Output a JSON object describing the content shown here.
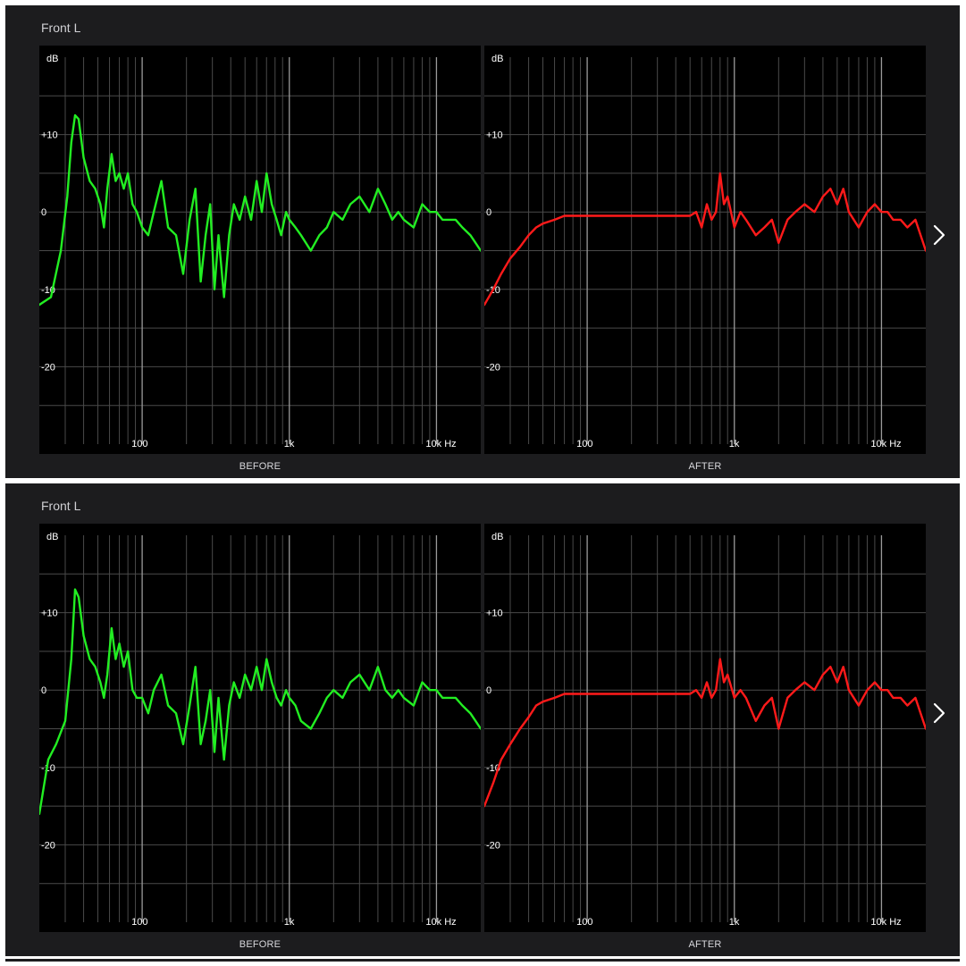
{
  "colors": {
    "panel_bg": "#1c1c1e",
    "plot_bg": "#000000",
    "grid": "#4a4a4a",
    "decade_grid": "#9a9a9a",
    "before_curve": "#22ee22",
    "after_curve": "#ff1a1a",
    "text": "#ffffff"
  },
  "icons": {
    "next": "chevron-right-icon"
  },
  "panels": [
    {
      "title": "Front L",
      "before_label": "BEFORE",
      "after_label": "AFTER",
      "y_unit": "dB",
      "x_unit_label": "10k Hz"
    },
    {
      "title": "Front L",
      "before_label": "BEFORE",
      "after_label": "AFTER",
      "y_unit": "dB",
      "x_unit_label": "10k Hz"
    }
  ],
  "chart_data": [
    {
      "type": "line",
      "title": "",
      "xlabel": "",
      "ylabel": "dB",
      "x_scale": "log",
      "xlim": [
        20,
        20000
      ],
      "ylim": [
        -30,
        20
      ],
      "x_ticks": [
        {
          "value": 100,
          "label": "100"
        },
        {
          "value": 1000,
          "label": "1k"
        },
        {
          "value": 10000,
          "label": "10k Hz"
        }
      ],
      "y_ticks": [
        {
          "value": 10,
          "label": "+10"
        },
        {
          "value": 0,
          "label": "0"
        },
        {
          "value": -10,
          "label": "-10"
        },
        {
          "value": -20,
          "label": "-20"
        }
      ],
      "grid": true,
      "series": [
        {
          "name": "",
          "color": "#22ee22",
          "x": [
            20,
            24,
            28,
            31,
            33,
            35,
            37,
            40,
            44,
            48,
            52,
            55,
            58,
            62,
            66,
            70,
            75,
            80,
            86,
            92,
            100,
            110,
            120,
            135,
            150,
            170,
            190,
            210,
            230,
            250,
            270,
            290,
            310,
            330,
            360,
            390,
            420,
            460,
            500,
            550,
            600,
            650,
            700,
            760,
            820,
            880,
            950,
            1000,
            1100,
            1200,
            1400,
            1600,
            1800,
            2000,
            2300,
            2600,
            3000,
            3500,
            4000,
            4500,
            5000,
            5500,
            6000,
            7000,
            8000,
            9000,
            10000,
            11000,
            12000,
            13500,
            15000,
            17000,
            20000
          ],
          "y": [
            -12,
            -11,
            -5,
            2,
            9,
            12.5,
            12,
            7,
            4,
            3,
            1,
            -2,
            3,
            7.5,
            4,
            5,
            3,
            5,
            1,
            0,
            -2,
            -3,
            0,
            4,
            -2,
            -3,
            -8,
            -1,
            3,
            -9,
            -3,
            1,
            -10,
            -3,
            -11,
            -3,
            1,
            -1,
            2,
            -1,
            4,
            0,
            5,
            1,
            -1,
            -3,
            0,
            -1,
            -2,
            -3,
            -5,
            -3,
            -2,
            0,
            -1,
            1,
            2,
            0,
            3,
            1,
            -1,
            0,
            -1,
            -2,
            1,
            0,
            0,
            -1,
            -1,
            -1,
            -2,
            -3,
            -5
          ]
        }
      ]
    },
    {
      "type": "line",
      "title": "",
      "xlabel": "",
      "ylabel": "dB",
      "x_scale": "log",
      "xlim": [
        20,
        20000
      ],
      "ylim": [
        -30,
        20
      ],
      "x_ticks": [
        {
          "value": 100,
          "label": "100"
        },
        {
          "value": 1000,
          "label": "1k"
        },
        {
          "value": 10000,
          "label": "10k Hz"
        }
      ],
      "y_ticks": [
        {
          "value": 10,
          "label": "+10"
        },
        {
          "value": 0,
          "label": "0"
        },
        {
          "value": -10,
          "label": "-10"
        },
        {
          "value": -20,
          "label": "-20"
        }
      ],
      "grid": true,
      "series": [
        {
          "name": "",
          "color": "#ff1a1a",
          "x": [
            20,
            23,
            26,
            30,
            35,
            40,
            45,
            50,
            60,
            70,
            80,
            90,
            100,
            150,
            200,
            250,
            300,
            400,
            450,
            500,
            550,
            600,
            650,
            700,
            750,
            800,
            850,
            900,
            1000,
            1100,
            1200,
            1400,
            1600,
            1800,
            2000,
            2300,
            2600,
            3000,
            3500,
            4000,
            4500,
            5000,
            5500,
            6000,
            7000,
            8000,
            9000,
            10000,
            11000,
            12000,
            13500,
            15000,
            17000,
            20000
          ],
          "y": [
            -12,
            -10,
            -8,
            -6,
            -4.5,
            -3,
            -2,
            -1.5,
            -1,
            -0.5,
            -0.5,
            -0.5,
            -0.5,
            -0.5,
            -0.5,
            -0.5,
            -0.5,
            -0.5,
            -0.5,
            -0.5,
            0,
            -2,
            1,
            -1,
            0,
            5,
            1,
            2,
            -2,
            0,
            -1,
            -3,
            -2,
            -1,
            -4,
            -1,
            0,
            1,
            0,
            2,
            3,
            1,
            3,
            0,
            -2,
            0,
            1,
            0,
            0,
            -1,
            -1,
            -2,
            -1,
            -5
          ]
        }
      ]
    },
    {
      "type": "line",
      "title": "",
      "xlabel": "",
      "ylabel": "dB",
      "x_scale": "log",
      "xlim": [
        20,
        20000
      ],
      "ylim": [
        -30,
        20
      ],
      "x_ticks": [
        {
          "value": 100,
          "label": "100"
        },
        {
          "value": 1000,
          "label": "1k"
        },
        {
          "value": 10000,
          "label": "10k Hz"
        }
      ],
      "y_ticks": [
        {
          "value": 10,
          "label": "+10"
        },
        {
          "value": 0,
          "label": "0"
        },
        {
          "value": -10,
          "label": "-10"
        },
        {
          "value": -20,
          "label": "-20"
        }
      ],
      "grid": true,
      "series": [
        {
          "name": "",
          "color": "#22ee22",
          "x": [
            20,
            23,
            26,
            30,
            33,
            35,
            37,
            40,
            44,
            48,
            52,
            55,
            58,
            62,
            66,
            70,
            75,
            80,
            86,
            92,
            100,
            110,
            120,
            135,
            150,
            170,
            190,
            210,
            230,
            250,
            270,
            290,
            310,
            330,
            360,
            390,
            420,
            460,
            500,
            550,
            600,
            650,
            700,
            760,
            820,
            880,
            950,
            1000,
            1100,
            1200,
            1400,
            1600,
            1800,
            2000,
            2300,
            2600,
            3000,
            3500,
            4000,
            4500,
            5000,
            5500,
            6000,
            7000,
            8000,
            9000,
            10000,
            11000,
            12000,
            13500,
            15000,
            17000,
            20000
          ],
          "y": [
            -16,
            -9,
            -7,
            -4,
            4,
            13,
            12,
            7,
            4,
            3,
            1,
            -1,
            2,
            8,
            4,
            6,
            3,
            5,
            0,
            -1,
            -1,
            -3,
            0,
            2,
            -2,
            -3,
            -7,
            -2,
            3,
            -7,
            -4,
            0,
            -8,
            -1,
            -9,
            -2,
            1,
            -1,
            2,
            0,
            3,
            0,
            4,
            1,
            -1,
            -2,
            0,
            -1,
            -2,
            -4,
            -5,
            -3,
            -1,
            0,
            -1,
            1,
            2,
            0,
            3,
            0,
            -1,
            0,
            -1,
            -2,
            1,
            0,
            0,
            -1,
            -1,
            -1,
            -2,
            -3,
            -5
          ]
        }
      ]
    },
    {
      "type": "line",
      "title": "",
      "xlabel": "",
      "ylabel": "dB",
      "x_scale": "log",
      "xlim": [
        20,
        20000
      ],
      "ylim": [
        -30,
        20
      ],
      "x_ticks": [
        {
          "value": 100,
          "label": "100"
        },
        {
          "value": 1000,
          "label": "1k"
        },
        {
          "value": 10000,
          "label": "10k Hz"
        }
      ],
      "y_ticks": [
        {
          "value": 10,
          "label": "+10"
        },
        {
          "value": 0,
          "label": "0"
        },
        {
          "value": -10,
          "label": "-10"
        },
        {
          "value": -20,
          "label": "-20"
        }
      ],
      "grid": true,
      "series": [
        {
          "name": "",
          "color": "#ff1a1a",
          "x": [
            20,
            23,
            26,
            30,
            35,
            40,
            45,
            50,
            60,
            70,
            80,
            90,
            100,
            150,
            200,
            250,
            300,
            400,
            450,
            500,
            550,
            600,
            650,
            700,
            750,
            800,
            850,
            900,
            1000,
            1100,
            1200,
            1400,
            1600,
            1800,
            2000,
            2300,
            2600,
            3000,
            3500,
            4000,
            4500,
            5000,
            5500,
            6000,
            7000,
            8000,
            9000,
            10000,
            11000,
            12000,
            13500,
            15000,
            17000,
            20000
          ],
          "y": [
            -15,
            -12,
            -9,
            -7,
            -5,
            -3.5,
            -2,
            -1.5,
            -1,
            -0.5,
            -0.5,
            -0.5,
            -0.5,
            -0.5,
            -0.5,
            -0.5,
            -0.5,
            -0.5,
            -0.5,
            -0.5,
            0,
            -1,
            1,
            -1,
            0,
            4,
            1,
            2,
            -1,
            0,
            -1,
            -4,
            -2,
            -1,
            -5,
            -1,
            0,
            1,
            0,
            2,
            3,
            1,
            3,
            0,
            -2,
            0,
            1,
            0,
            0,
            -1,
            -1,
            -2,
            -1,
            -5
          ]
        }
      ]
    }
  ]
}
